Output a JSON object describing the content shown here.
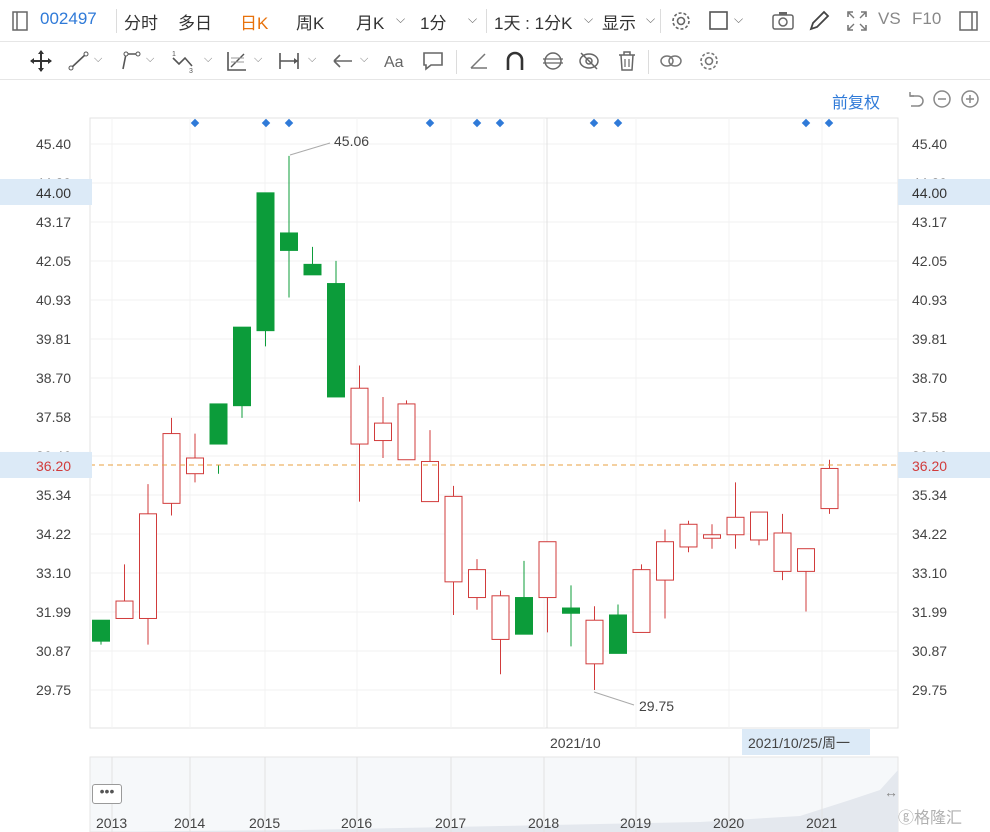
{
  "toolbar": {
    "stock_code": "002497",
    "tabs": [
      "分时",
      "多日",
      "日K",
      "周K",
      "月K",
      "1分",
      "1天 : 1分K",
      "显示"
    ],
    "active_tab": "日K",
    "vs_label": "VS",
    "f10_label": "F10"
  },
  "colors": {
    "accent": "#2f7ad8",
    "active_tab": "#e8720c",
    "up": "#d13b3b",
    "down": "#0c9c3a",
    "crosshair": "#e8a040",
    "highlight_bg": "#dceaf7"
  },
  "drawing_icons": [
    "move-icon",
    "line-icon",
    "polyline-icon",
    "wave-icon",
    "fibonacci-icon",
    "range-icon",
    "arrow-icon",
    "text-icon",
    "comment-icon",
    "ruler-icon",
    "magnet-icon",
    "lock-icon",
    "hide-icon",
    "trash-icon",
    "link-icon",
    "settings-icon"
  ],
  "adjust_label": "前复权",
  "chart_data": {
    "type": "candlestick",
    "y_ticks": [
      "45.40",
      "44.29",
      "43.17",
      "42.05",
      "40.93",
      "39.81",
      "38.70",
      "37.58",
      "36.46",
      "35.34",
      "34.22",
      "33.10",
      "31.99",
      "30.87",
      "29.75"
    ],
    "ylim": [
      29.0,
      46.0
    ],
    "high_label": "45.06",
    "low_label": "29.75",
    "crosshair_price": "36.20",
    "crosshair_upper_price": "44.00",
    "vertical_marker_label": "2021/10",
    "date_label": "2021/10/25/周一",
    "x_labels": [
      "2013",
      "2014",
      "2015",
      "2016",
      "2017",
      "2018",
      "2019",
      "2020",
      "2021"
    ],
    "candles": [
      [
        31.75,
        31.15,
        31.05,
        31.7,
        32.1
      ],
      [
        31.8,
        32.3,
        31.8,
        33.35,
        34.25
      ],
      [
        31.8,
        34.8,
        31.05,
        35.65,
        36.4
      ],
      [
        35.1,
        37.1,
        34.75,
        37.55,
        38.05
      ],
      [
        35.95,
        36.4,
        35.7,
        37.1,
        37.6
      ],
      [
        37.95,
        36.8,
        35.95,
        36.2,
        39.8
      ],
      [
        40.15,
        37.9,
        37.55,
        38.05,
        40.95
      ],
      [
        44.0,
        40.05,
        39.6,
        40.35,
        44.0
      ],
      [
        42.85,
        42.35,
        41.0,
        45.06,
        42.85
      ],
      [
        41.95,
        41.65,
        41.95,
        42.45,
        41.4
      ],
      [
        41.4,
        38.15,
        38.15,
        42.05,
        38.15
      ],
      [
        36.8,
        38.4,
        35.15,
        39.05,
        38.4
      ],
      [
        36.9,
        37.4,
        36.4,
        38.15,
        36.9
      ],
      [
        36.35,
        37.95,
        36.35,
        38.05,
        36.35
      ],
      [
        35.15,
        36.3,
        35.15,
        37.2,
        35.1
      ],
      [
        32.85,
        35.3,
        31.9,
        35.6,
        32.85
      ],
      [
        32.4,
        33.2,
        32.05,
        33.5,
        32.4
      ],
      [
        31.2,
        32.45,
        30.2,
        32.6,
        31.2
      ],
      [
        32.4,
        31.35,
        31.35,
        33.45,
        31.35
      ],
      [
        32.4,
        34.0,
        31.4,
        34.0,
        32.4
      ],
      [
        32.1,
        31.95,
        31.0,
        32.75,
        32.1
      ],
      [
        30.5,
        31.75,
        29.75,
        32.15,
        30.5
      ],
      [
        31.9,
        30.8,
        30.8,
        32.2,
        30.8
      ],
      [
        31.4,
        33.2,
        31.4,
        33.35,
        31.4
      ],
      [
        32.9,
        34.0,
        31.8,
        34.35,
        32.9
      ],
      [
        33.85,
        34.5,
        33.7,
        34.6,
        33.85
      ],
      [
        34.1,
        34.2,
        33.8,
        34.5,
        34.1
      ],
      [
        34.2,
        34.7,
        33.8,
        35.7,
        34.2
      ],
      [
        34.05,
        34.85,
        33.9,
        34.85,
        34.05
      ],
      [
        33.15,
        34.25,
        32.9,
        34.8,
        33.15
      ],
      [
        33.15,
        33.8,
        32.0,
        33.8,
        33.15
      ],
      [
        34.95,
        36.1,
        34.8,
        36.35,
        34.95
      ]
    ],
    "candle_fields": [
      "open",
      "close",
      "low",
      "high",
      "body_bottom"
    ]
  }
}
